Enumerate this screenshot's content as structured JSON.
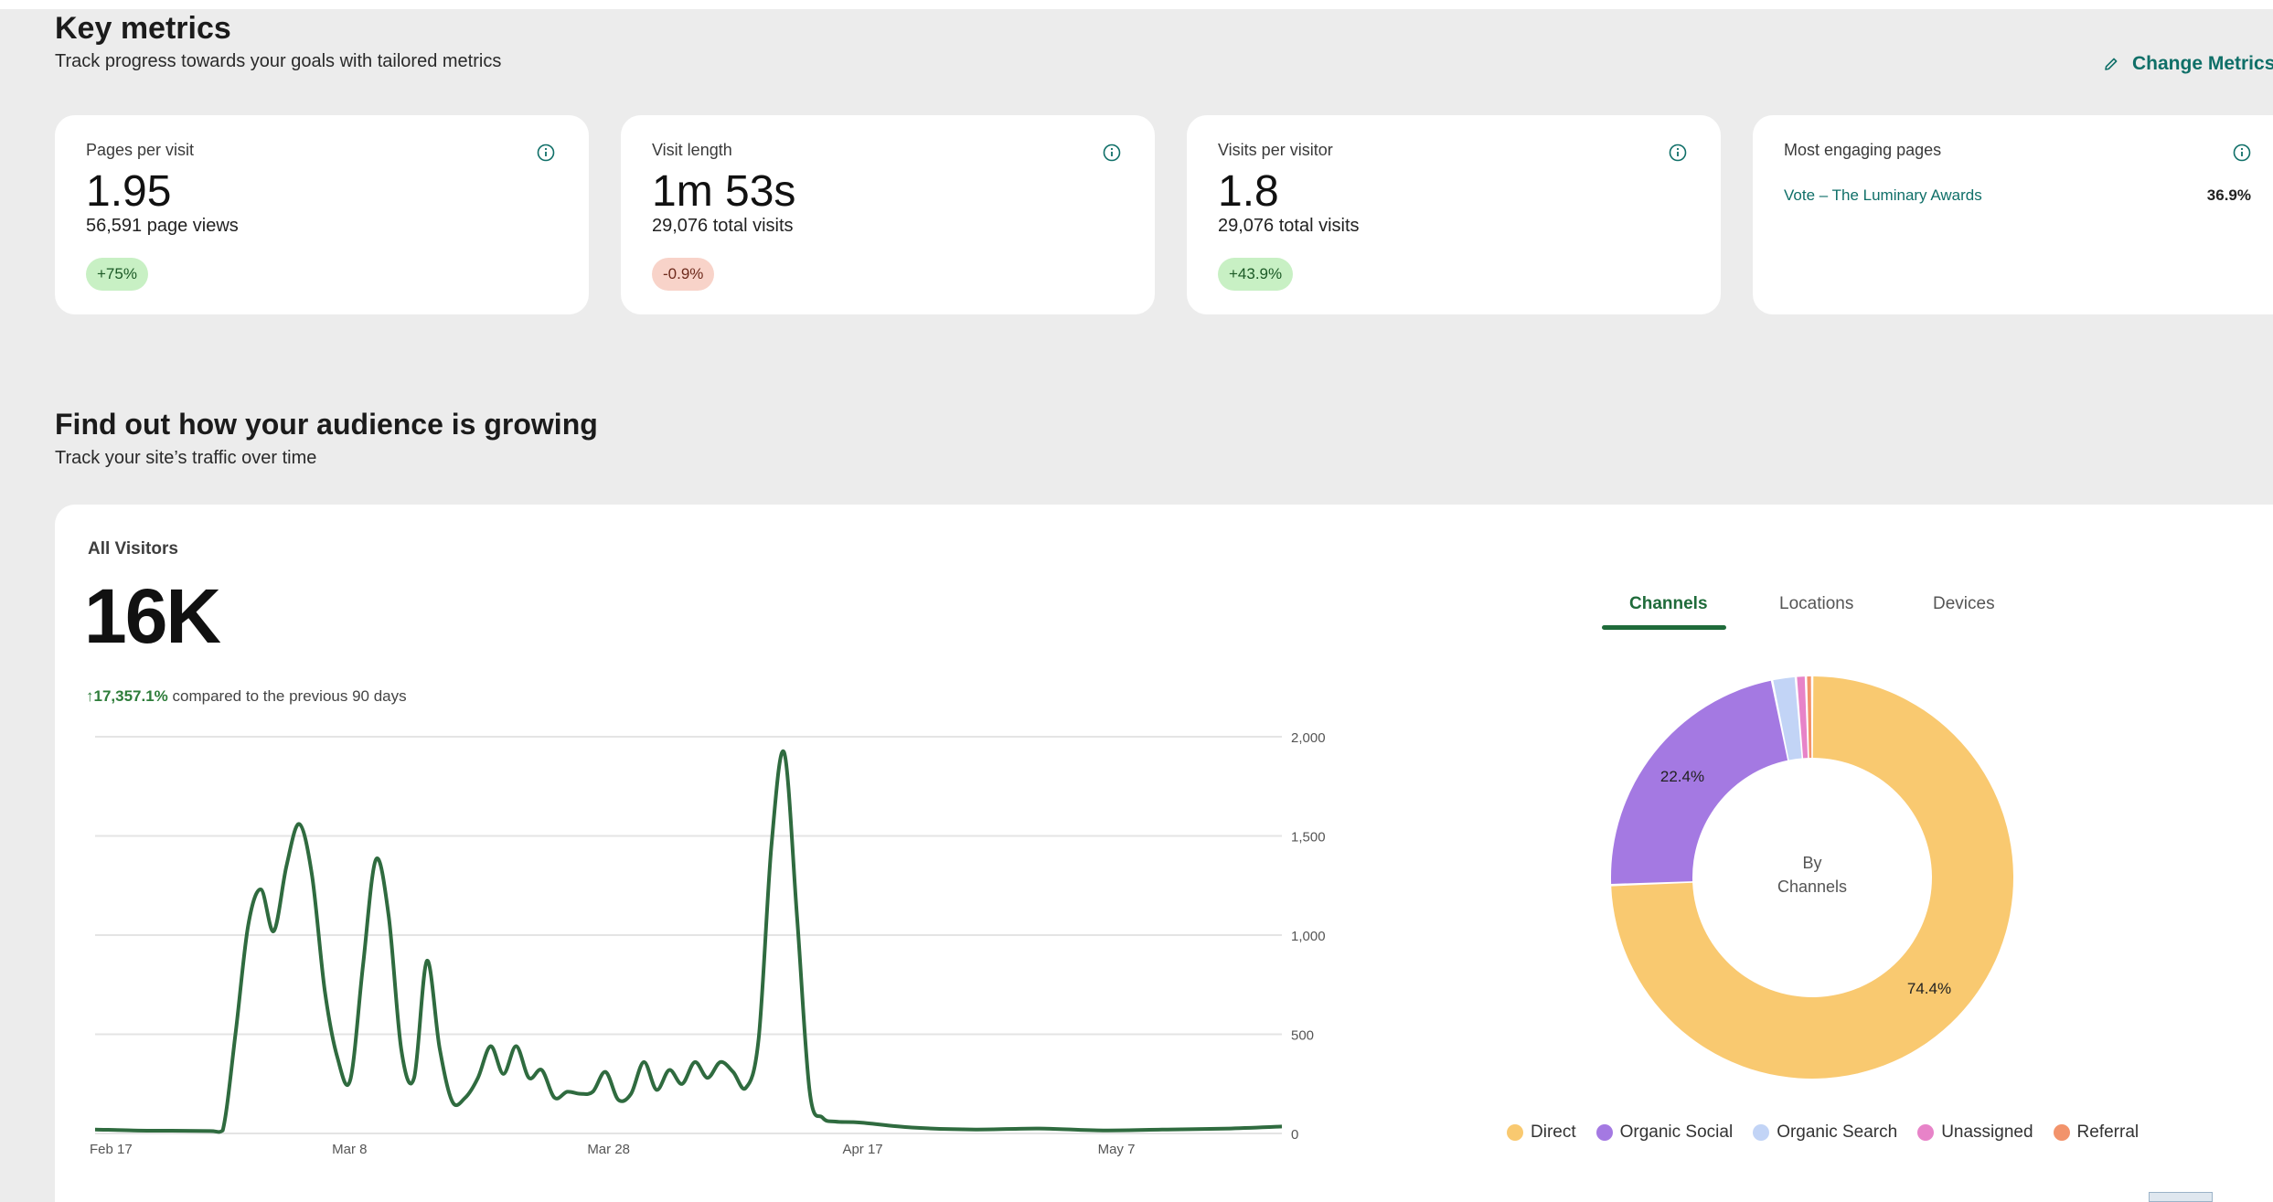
{
  "header": {
    "title": "Key metrics",
    "subtitle": "Track progress towards your goals with tailored metrics",
    "change_metrics_label": "Change Metrics"
  },
  "metrics": [
    {
      "label": "Pages per visit",
      "value": "1.95",
      "detail": "56,591 page views",
      "delta": "+75%",
      "trend": "up"
    },
    {
      "label": "Visit length",
      "value": "1m 53s",
      "detail": "29,076 total visits",
      "delta": "-0.9%",
      "trend": "down"
    },
    {
      "label": "Visits per visitor",
      "value": "1.8",
      "detail": "29,076 total visits",
      "delta": "+43.9%",
      "trend": "up"
    }
  ],
  "engaging": {
    "label": "Most engaging pages",
    "page": "Vote – The Luminary Awards",
    "value": "36.9%"
  },
  "growth": {
    "title": "Find out how your audience is growing",
    "subtitle": "Track your site’s traffic over time"
  },
  "visitors": {
    "label": "All Visitors",
    "total": "16K",
    "change": "17,357.1%",
    "change_text": "compared to the previous 90 days"
  },
  "tabs": [
    "Channels",
    "Locations",
    "Devices"
  ],
  "donut_center": [
    "By",
    "Channels"
  ],
  "colors": {
    "line": "#2f6b3f",
    "accent": "#0f6f68",
    "direct": "#f9c970",
    "organic_social": "#a479e2",
    "organic_search": "#c2d4f6",
    "unassigned": "#e783c8",
    "referral": "#f2936b"
  },
  "chart_data": [
    {
      "type": "line",
      "title": "All Visitors",
      "x_ticks": [
        "Feb 17",
        "Mar 8",
        "Mar 28",
        "Apr 17",
        "May 7"
      ],
      "y_ticks": [
        "2,000",
        "1,500",
        "1,000",
        "500",
        "0"
      ],
      "ylim": [
        0,
        2000
      ],
      "grid": true,
      "series": [
        {
          "points": [
            [
              "2025-02-17",
              20
            ],
            [
              "2025-02-20",
              15
            ],
            [
              "2025-02-23",
              14
            ],
            [
              "2025-02-26",
              12
            ],
            [
              "2025-02-27",
              15
            ],
            [
              "2025-02-28",
              500
            ],
            [
              "2025-03-01",
              1050
            ],
            [
              "2025-03-02",
              1230
            ],
            [
              "2025-03-03",
              1020
            ],
            [
              "2025-03-04",
              1350
            ],
            [
              "2025-03-05",
              1560
            ],
            [
              "2025-03-06",
              1300
            ],
            [
              "2025-03-07",
              720
            ],
            [
              "2025-03-08",
              380
            ],
            [
              "2025-03-09",
              270
            ],
            [
              "2025-03-10",
              850
            ],
            [
              "2025-03-11",
              1380
            ],
            [
              "2025-03-12",
              1100
            ],
            [
              "2025-03-13",
              420
            ],
            [
              "2025-03-14",
              280
            ],
            [
              "2025-03-15",
              870
            ],
            [
              "2025-03-16",
              430
            ],
            [
              "2025-03-17",
              160
            ],
            [
              "2025-03-18",
              180
            ],
            [
              "2025-03-19",
              280
            ],
            [
              "2025-03-20",
              440
            ],
            [
              "2025-03-21",
              300
            ],
            [
              "2025-03-22",
              440
            ],
            [
              "2025-03-23",
              280
            ],
            [
              "2025-03-24",
              320
            ],
            [
              "2025-03-25",
              180
            ],
            [
              "2025-03-26",
              210
            ],
            [
              "2025-03-27",
              200
            ],
            [
              "2025-03-28",
              210
            ],
            [
              "2025-03-29",
              310
            ],
            [
              "2025-03-30",
              170
            ],
            [
              "2025-03-31",
              200
            ],
            [
              "2025-04-01",
              360
            ],
            [
              "2025-04-02",
              220
            ],
            [
              "2025-04-03",
              320
            ],
            [
              "2025-04-04",
              250
            ],
            [
              "2025-04-05",
              360
            ],
            [
              "2025-04-06",
              280
            ],
            [
              "2025-04-07",
              360
            ],
            [
              "2025-04-08",
              310
            ],
            [
              "2025-04-09",
              230
            ],
            [
              "2025-04-10",
              480
            ],
            [
              "2025-04-11",
              1450
            ],
            [
              "2025-04-12",
              1920
            ],
            [
              "2025-04-13",
              1100
            ],
            [
              "2025-04-14",
              210
            ],
            [
              "2025-04-15",
              80
            ],
            [
              "2025-04-16",
              60
            ],
            [
              "2025-04-18",
              55
            ],
            [
              "2025-04-22",
              30
            ],
            [
              "2025-04-27",
              20
            ],
            [
              "2025-05-02",
              25
            ],
            [
              "2025-05-07",
              15
            ],
            [
              "2025-05-12",
              20
            ],
            [
              "2025-05-17",
              25
            ],
            [
              "2025-05-21",
              35
            ]
          ]
        }
      ]
    },
    {
      "type": "pie",
      "title": "By Channels",
      "categories": [
        "Direct",
        "Organic Social",
        "Organic Search",
        "Unassigned",
        "Referral"
      ],
      "values": [
        74.4,
        22.4,
        1.9,
        0.8,
        0.5
      ],
      "data_labels": [
        "74.4%",
        "22.4%"
      ],
      "legend": "bottom"
    }
  ]
}
